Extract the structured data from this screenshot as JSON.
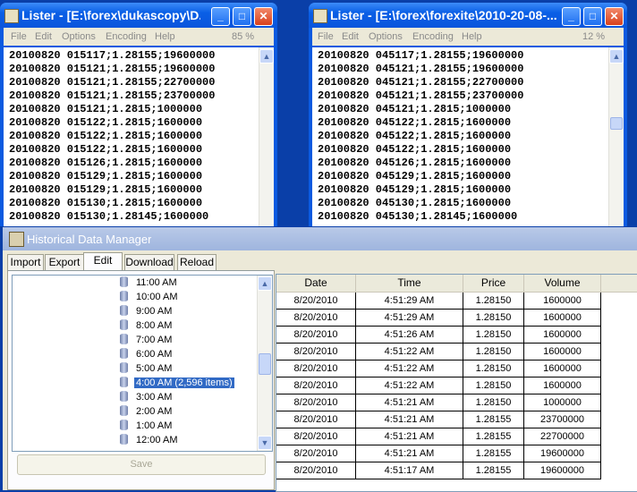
{
  "lister_left": {
    "title": "Lister - [E:\\forex\\dukascopy\\D...",
    "menu": [
      "File",
      "Edit",
      "Options",
      "Encoding",
      "Help"
    ],
    "percent": "85 %",
    "lines": [
      "20100820 015117;1.28155;19600000",
      "20100820 015121;1.28155;19600000",
      "20100820 015121;1.28155;22700000",
      "20100820 015121;1.28155;23700000",
      "20100820 015121;1.2815;1000000",
      "20100820 015122;1.2815;1600000",
      "20100820 015122;1.2815;1600000",
      "20100820 015122;1.2815;1600000",
      "20100820 015126;1.2815;1600000",
      "20100820 015129;1.2815;1600000",
      "20100820 015129;1.2815;1600000",
      "20100820 015130;1.2815;1600000",
      "20100820 015130;1.28145;1600000"
    ]
  },
  "lister_right": {
    "title": "Lister - [E:\\forex\\forexite\\2010-20-08-...",
    "menu": [
      "File",
      "Edit",
      "Options",
      "Encoding",
      "Help"
    ],
    "percent": "12 %",
    "lines": [
      "20100820 045117;1.28155;19600000",
      "20100820 045121;1.28155;19600000",
      "20100820 045121;1.28155;22700000",
      "20100820 045121;1.28155;23700000",
      "20100820 045121;1.2815;1000000",
      "20100820 045122;1.2815;1600000",
      "20100820 045122;1.2815;1600000",
      "20100820 045122;1.2815;1600000",
      "20100820 045126;1.2815;1600000",
      "20100820 045129;1.2815;1600000",
      "20100820 045129;1.2815;1600000",
      "20100820 045130;1.2815;1600000",
      "20100820 045130;1.28145;1600000"
    ]
  },
  "window_buttons": {
    "minimize": "_",
    "maximize": "□",
    "close": "✕"
  },
  "hdm": {
    "title": "Historical Data Manager",
    "tabs": [
      "Import",
      "Export",
      "Edit",
      "Download",
      "Reload"
    ],
    "active_tab": "Edit",
    "tree": [
      "11:00 AM",
      "10:00 AM",
      "9:00 AM",
      "8:00 AM",
      "7:00 AM",
      "6:00 AM",
      "5:00 AM",
      "4:00 AM (2,596 items)",
      "3:00 AM",
      "2:00 AM",
      "1:00 AM",
      "12:00 AM"
    ],
    "selected_node": "4:00 AM (2,596 items)",
    "save_label": "Save",
    "columns": [
      "Date",
      "Time",
      "Price",
      "Volume"
    ],
    "rows": [
      [
        "8/20/2010",
        "4:51:29 AM",
        "1.28150",
        "1600000"
      ],
      [
        "8/20/2010",
        "4:51:29 AM",
        "1.28150",
        "1600000"
      ],
      [
        "8/20/2010",
        "4:51:26 AM",
        "1.28150",
        "1600000"
      ],
      [
        "8/20/2010",
        "4:51:22 AM",
        "1.28150",
        "1600000"
      ],
      [
        "8/20/2010",
        "4:51:22 AM",
        "1.28150",
        "1600000"
      ],
      [
        "8/20/2010",
        "4:51:22 AM",
        "1.28150",
        "1600000"
      ],
      [
        "8/20/2010",
        "4:51:21 AM",
        "1.28150",
        "1000000"
      ],
      [
        "8/20/2010",
        "4:51:21 AM",
        "1.28155",
        "23700000"
      ],
      [
        "8/20/2010",
        "4:51:21 AM",
        "1.28155",
        "22700000"
      ],
      [
        "8/20/2010",
        "4:51:21 AM",
        "1.28155",
        "19600000"
      ],
      [
        "8/20/2010",
        "4:51:17 AM",
        "1.28155",
        "19600000"
      ]
    ]
  }
}
